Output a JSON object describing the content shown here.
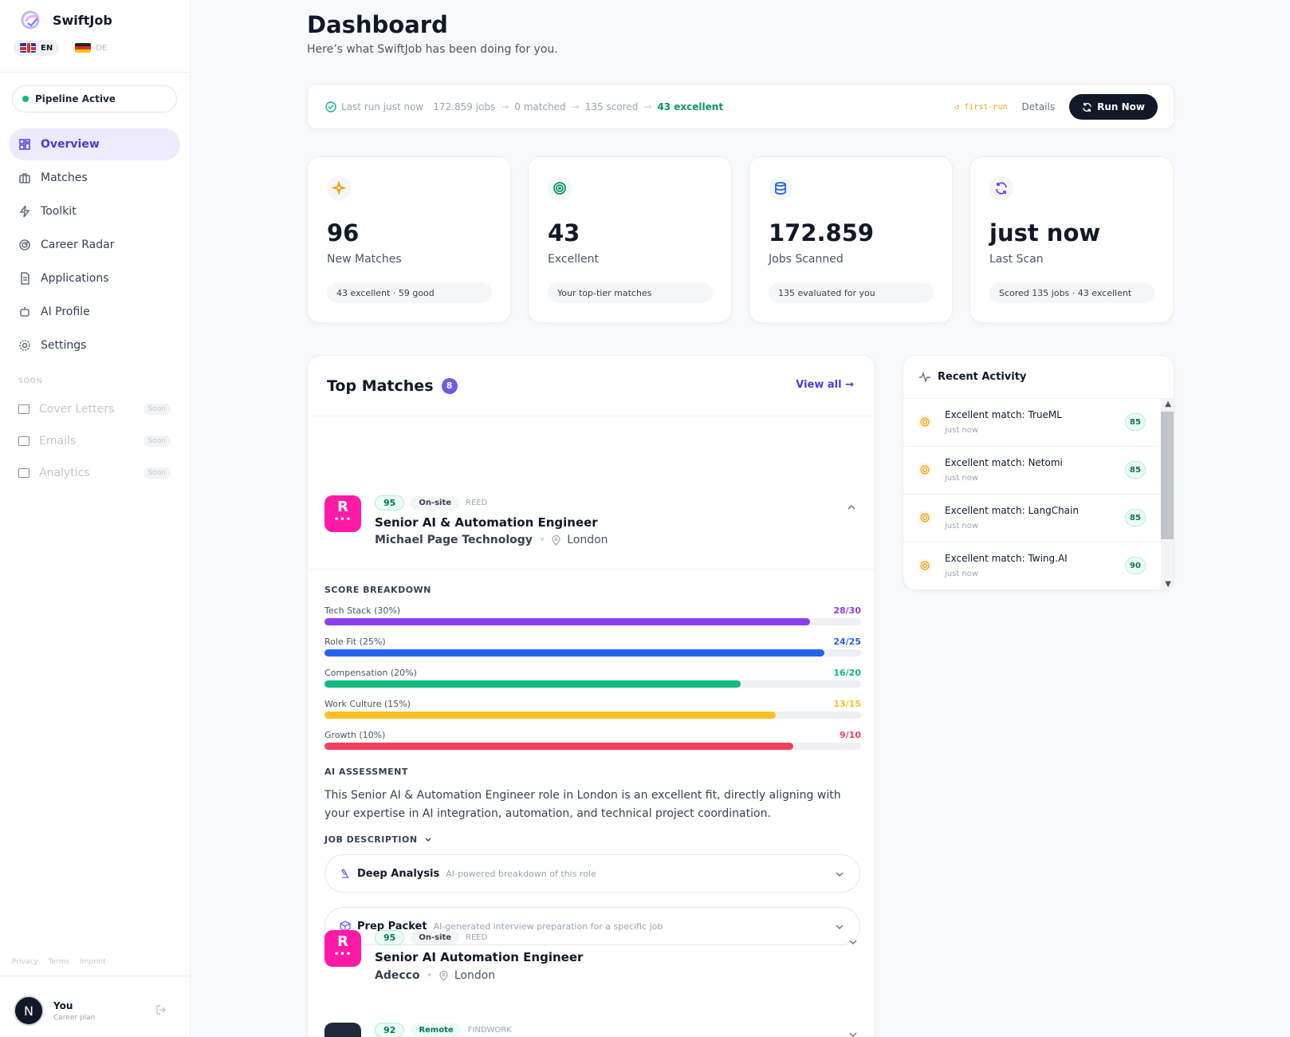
{
  "brand": {
    "name": "SwiftJob"
  },
  "languages": [
    {
      "code": "EN",
      "active": true
    },
    {
      "code": "DE",
      "active": false
    }
  ],
  "pipeline": {
    "label": "Pipeline Active",
    "color": "#10b981"
  },
  "nav": [
    {
      "label": "Overview",
      "icon": "grid-icon",
      "active": true
    },
    {
      "label": "Matches",
      "icon": "briefcase-icon"
    },
    {
      "label": "Toolkit",
      "icon": "bolt-icon"
    },
    {
      "label": "Career Radar",
      "icon": "radar-icon"
    },
    {
      "label": "Applications",
      "icon": "document-icon"
    },
    {
      "label": "AI Profile",
      "icon": "bot-icon"
    },
    {
      "label": "Settings",
      "icon": "gear-icon"
    }
  ],
  "soon_section": {
    "label": "SOON",
    "items": [
      {
        "label": "Cover Letters",
        "badge": "Soon"
      },
      {
        "label": "Emails",
        "badge": "Soon"
      },
      {
        "label": "Analytics",
        "badge": "Soon"
      }
    ]
  },
  "footer_links": [
    "Privacy",
    "Terms",
    "Imprint"
  ],
  "user": {
    "initial": "N",
    "name": "You",
    "plan": "Career plan"
  },
  "header": {
    "title": "Dashboard",
    "subtitle": "Here’s what SwiftJob has been doing for you."
  },
  "run_status": {
    "last_run": "Last run just now",
    "jobs": "172.859 jobs",
    "matched": "0 matched",
    "scored": "135 scored",
    "excellent": "43 excellent",
    "tag": "↺ first-run",
    "details_label": "Details",
    "run_button": "Run Now"
  },
  "stats": [
    {
      "value": "96",
      "label": "New Matches",
      "pill": "43 excellent · 59 good",
      "icon": "sparkle-icon",
      "color": "#f59e0b"
    },
    {
      "value": "43",
      "label": "Excellent",
      "pill": "Your top-tier matches",
      "icon": "target-icon",
      "color": "#059669"
    },
    {
      "value": "172.859",
      "label": "Jobs Scanned",
      "pill": "135 evaluated for you",
      "icon": "database-icon",
      "color": "#2563eb"
    },
    {
      "value": "just now",
      "label": "Last Scan",
      "pill": "Scored 135 jobs · 43 excellent",
      "icon": "refresh-icon",
      "color": "#7c3aed"
    }
  ],
  "top_matches": {
    "title": "Top Matches",
    "count": "8",
    "view_all": "View all →",
    "jobs": [
      {
        "score": "95",
        "site": "On-site",
        "source": "REED",
        "title": "Senior AI & Automation Engineer",
        "company": "Michael Page Technology",
        "location": "London",
        "logo": "R",
        "expanded": true
      },
      {
        "score": "95",
        "site": "On-site",
        "source": "REED",
        "title": "Senior AI Automation Engineer",
        "company": "Adecco",
        "location": "London",
        "logo": "R",
        "expanded": false
      },
      {
        "score": "92",
        "site": "Remote",
        "source": "FINDWORK",
        "logo": "",
        "expanded": false
      }
    ],
    "breakdown": {
      "heading": "SCORE BREAKDOWN",
      "rows": [
        {
          "label": "Tech Stack (30%)",
          "score": "28/30",
          "value": 28,
          "max": 30,
          "color": "#8b3ef0"
        },
        {
          "label": "Role Fit (25%)",
          "score": "24/25",
          "value": 24,
          "max": 25,
          "color": "#2563eb"
        },
        {
          "label": "Compensation (20%)",
          "score": "16/20",
          "value": 16,
          "max": 20,
          "color": "#10b981"
        },
        {
          "label": "Work Culture (15%)",
          "score": "13/15",
          "value": 13,
          "max": 15,
          "color": "#fbbf24"
        },
        {
          "label": "Growth (10%)",
          "score": "9/10",
          "value": 9,
          "max": 10,
          "color": "#f43f5e"
        }
      ]
    },
    "ai_assessment": {
      "heading": "AI ASSESSMENT",
      "text": "This Senior AI & Automation Engineer role in London is an excellent fit, directly aligning with your expertise in AI integration, automation, and technical project coordination."
    },
    "job_description_label": "JOB DESCRIPTION",
    "accordions": [
      {
        "title": "Deep Analysis",
        "subtitle": "AI-powered breakdown of this role",
        "icon": "microscope-icon"
      },
      {
        "title": "Prep Packet",
        "subtitle": "AI-generated interview preparation for a specific job",
        "icon": "package-icon"
      }
    ]
  },
  "recent_activity": {
    "title": "Recent Activity",
    "items": [
      {
        "title": "Excellent match: TrueML",
        "time": "just now",
        "score": "85"
      },
      {
        "title": "Excellent match: Netomi",
        "time": "just now",
        "score": "85"
      },
      {
        "title": "Excellent match: LangChain",
        "time": "just now",
        "score": "85"
      },
      {
        "title": "Excellent match: Twing.AI",
        "time": "just now",
        "score": "90"
      }
    ]
  }
}
